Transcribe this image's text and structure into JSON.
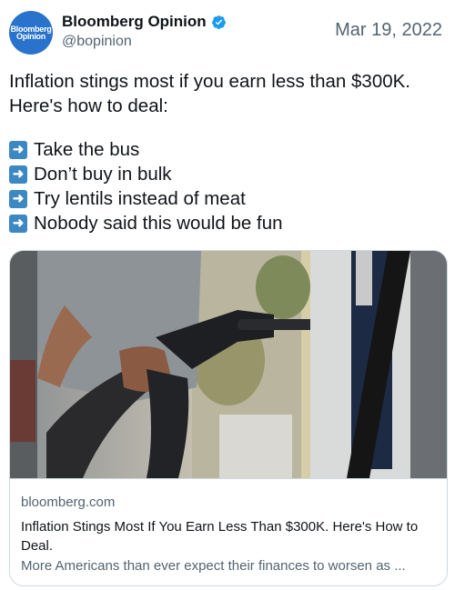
{
  "author": {
    "display_name": "Bloomberg Opinion",
    "handle": "@bopinion",
    "avatar_text_line1": "Bloomberg",
    "avatar_text_line2": "Opinion",
    "avatar_color": "#2a73cc",
    "verified_color": "#1d9bf0"
  },
  "date": "Mar 19, 2022",
  "tweet": {
    "line1": "Inflation stings most if you earn less than $300K.",
    "line2": "Here's how to deal:",
    "bullets": [
      {
        "icon": "right-arrow-emoji",
        "text": "Take the bus"
      },
      {
        "icon": "right-arrow-emoji",
        "text": "Don’t buy in bulk"
      },
      {
        "icon": "right-arrow-emoji",
        "text": "Try lentils instead of meat"
      },
      {
        "icon": "right-arrow-emoji",
        "text": "Nobody said this would be fun"
      }
    ]
  },
  "card": {
    "image_subject": "person-pumping-gas-photo",
    "domain": "bloomberg.com",
    "headline": "Inflation Stings Most If You Earn Less Than $300K. Here's How to Deal.",
    "description": "More Americans than ever expect their finances to worsen as ..."
  }
}
